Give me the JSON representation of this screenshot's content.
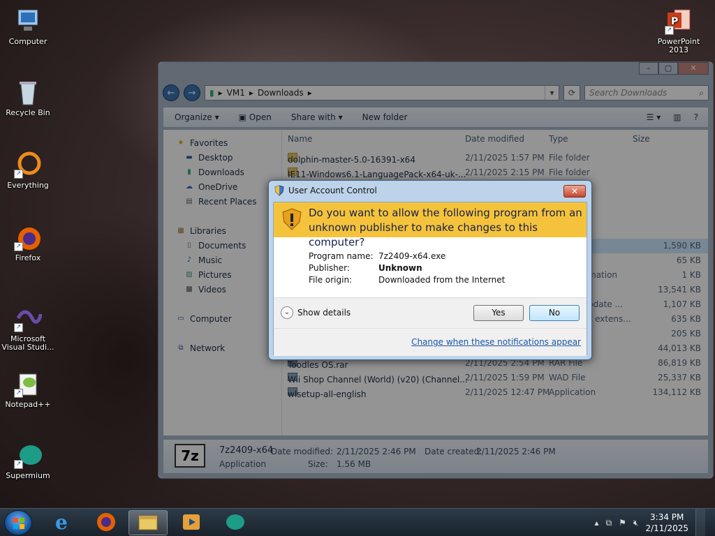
{
  "desktop": {
    "icons": [
      {
        "label": "Computer",
        "icon": "computer-icon"
      },
      {
        "label": "Recycle Bin",
        "icon": "recycle-bin-icon"
      },
      {
        "label": "Everything",
        "icon": "everything-icon"
      },
      {
        "label": "Firefox",
        "icon": "firefox-icon"
      },
      {
        "label": "Microsoft Visual Studi...",
        "icon": "visual-studio-icon"
      },
      {
        "label": "Notepad++",
        "icon": "notepad-plus-plus-icon"
      },
      {
        "label": "Supermium",
        "icon": "supermium-icon"
      },
      {
        "label": "PowerPoint 2013",
        "icon": "powerpoint-icon"
      }
    ]
  },
  "explorer": {
    "breadcrumb": [
      "VM1",
      "Downloads"
    ],
    "search_placeholder": "Search Downloads",
    "toolbar": {
      "organize": "Organize",
      "open": "Open",
      "share_with": "Share with",
      "new_folder": "New folder"
    },
    "navpane": {
      "favorites": "Favorites",
      "desktop": "Desktop",
      "downloads": "Downloads",
      "onedrive": "OneDrive",
      "recent_places": "Recent Places",
      "libraries": "Libraries",
      "documents": "Documents",
      "music": "Music",
      "pictures": "Pictures",
      "videos": "Videos",
      "computer": "Computer",
      "network": "Network"
    },
    "columns": {
      "name": "Name",
      "date_modified": "Date modified",
      "type": "Type",
      "size": "Size"
    },
    "files": [
      {
        "name": "dolphin-master-5.0-16391-x64",
        "date": "2/11/2025 1:57 PM",
        "type": "File folder",
        "size": ""
      },
      {
        "name": "IE11-Windows6.1-LanguagePack-x64-uk-...",
        "date": "2/11/2025 2:15 PM",
        "type": "File folder",
        "size": ""
      }
    ],
    "partial_rows": [
      {
        "type": "",
        "size": "1,590 KB"
      },
      {
        "type": "",
        "size": "65 KB"
      },
      {
        "type": "mation",
        "size": "1 KB"
      },
      {
        "type": "",
        "size": "13,541 KB"
      },
      {
        "type": "pdate ...",
        "size": "1,107 KB"
      },
      {
        "type": "s extens...",
        "size": "635 KB"
      },
      {
        "type": "",
        "size": "205 KB"
      },
      {
        "type": "",
        "size": "44,013 KB"
      }
    ],
    "files_bottom": [
      {
        "name": "Toodles OS.rar",
        "date": "2/11/2025 2:54 PM",
        "type": "RAR File",
        "size": "86,819 KB"
      },
      {
        "name": "Wii Shop Channel (World) (v20) (Channel...",
        "date": "2/11/2025 1:59 PM",
        "type": "WAD File",
        "size": "25,337 KB"
      },
      {
        "name": "wlsetup-all-english",
        "date": "2/11/2025 12:47 PM",
        "type": "Application",
        "size": "134,112 KB"
      }
    ],
    "details": {
      "name": "7z2409-x64",
      "type": "Application",
      "date_modified_label": "Date modified:",
      "date_modified": "2/11/2025 2:46 PM",
      "date_created_label": "Date created:",
      "date_created": "2/11/2025 2:46 PM",
      "size_label": "Size:",
      "size": "1.56 MB"
    }
  },
  "uac": {
    "title": "User Account Control",
    "question": "Do you want to allow the following program from an unknown publisher to make changes to this computer?",
    "program_name_label": "Program name:",
    "program_name": "7z2409-x64.exe",
    "publisher_label": "Publisher:",
    "publisher": "Unknown",
    "file_origin_label": "File origin:",
    "file_origin": "Downloaded from the Internet",
    "show_details": "Show details",
    "yes": "Yes",
    "no": "No",
    "change_link": "Change when these notifications appear",
    "accent": "#f5c33b"
  },
  "taskbar": {
    "clock_time": "3:34 PM",
    "clock_date": "2/11/2025",
    "pinned": [
      "internet-explorer-icon",
      "firefox-icon",
      "file-explorer-icon",
      "media-player-icon",
      "supermium-icon"
    ]
  }
}
